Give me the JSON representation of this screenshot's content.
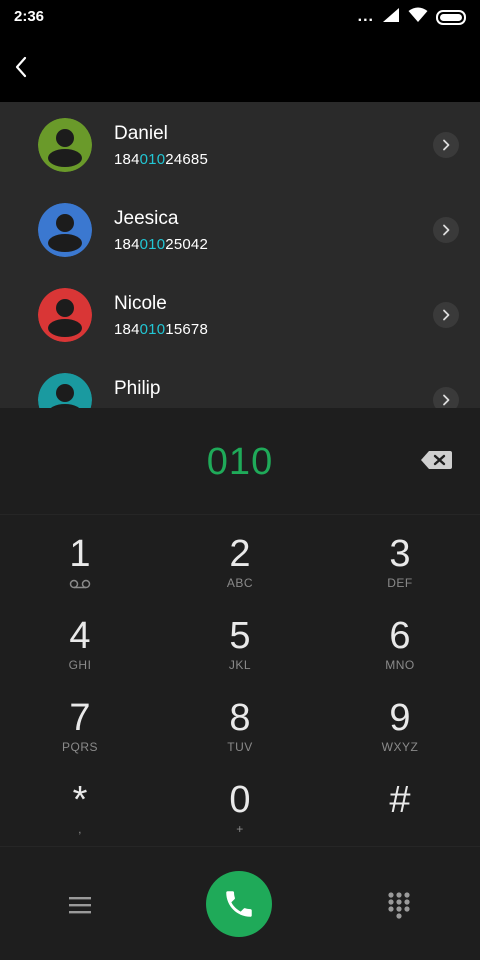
{
  "status_bar": {
    "time": "2:36",
    "dots": "...",
    "icons": [
      "signal-icon",
      "wifi-icon",
      "battery-icon"
    ]
  },
  "top_bar": {
    "back_icon": "chevron-left-icon"
  },
  "contacts": [
    {
      "name": "Daniel",
      "number_prefix": "184",
      "number_match": "010",
      "number_suffix": "24685",
      "avatar_color": "#6a9a2a"
    },
    {
      "name": "Jeesica",
      "number_prefix": "184",
      "number_match": "010",
      "number_suffix": "25042",
      "avatar_color": "#3b78d0"
    },
    {
      "name": "Nicole",
      "number_prefix": "184",
      "number_match": "010",
      "number_suffix": "15678",
      "avatar_color": "#d93636"
    },
    {
      "name": "Philip",
      "number_prefix": "",
      "number_match": "",
      "number_suffix": "",
      "avatar_color": "#1a9aa0"
    }
  ],
  "dialer": {
    "entry": "010",
    "entry_color": "#1faa59",
    "match_color": "#22c6d4",
    "keys": [
      {
        "digit": "1",
        "sub": "",
        "sub_icon": "voicemail-icon"
      },
      {
        "digit": "2",
        "sub": "ABC"
      },
      {
        "digit": "3",
        "sub": "DEF"
      },
      {
        "digit": "4",
        "sub": "GHI"
      },
      {
        "digit": "5",
        "sub": "JKL"
      },
      {
        "digit": "6",
        "sub": "MNO"
      },
      {
        "digit": "7",
        "sub": "PQRS"
      },
      {
        "digit": "8",
        "sub": "TUV"
      },
      {
        "digit": "9",
        "sub": "WXYZ"
      },
      {
        "digit": "*",
        "sub": ","
      },
      {
        "digit": "0",
        "sub": "+"
      },
      {
        "digit": "#",
        "sub": ""
      }
    ]
  },
  "bottom_bar": {
    "menu_icon": "menu-icon",
    "call_icon": "phone-icon",
    "dialpad_icon": "dialpad-icon"
  }
}
